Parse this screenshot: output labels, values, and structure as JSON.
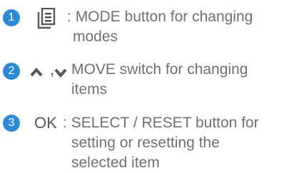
{
  "accent_color": "#2a8ad8",
  "items": [
    {
      "number": "1",
      "icon": "mode-document-icon",
      "text_lines": [
        "MODE button for changing",
        "modes"
      ],
      "separator": ":"
    },
    {
      "number": "2",
      "icon": "up-down-chevron-icon",
      "symbol_separator": ",",
      "text_lines": [
        "MOVE switch for changing",
        "items"
      ]
    },
    {
      "number": "3",
      "symbol": "OK",
      "separator": ":",
      "text_lines": [
        "SELECT / RESET button for",
        "setting or resetting the",
        "selected item"
      ]
    }
  ]
}
